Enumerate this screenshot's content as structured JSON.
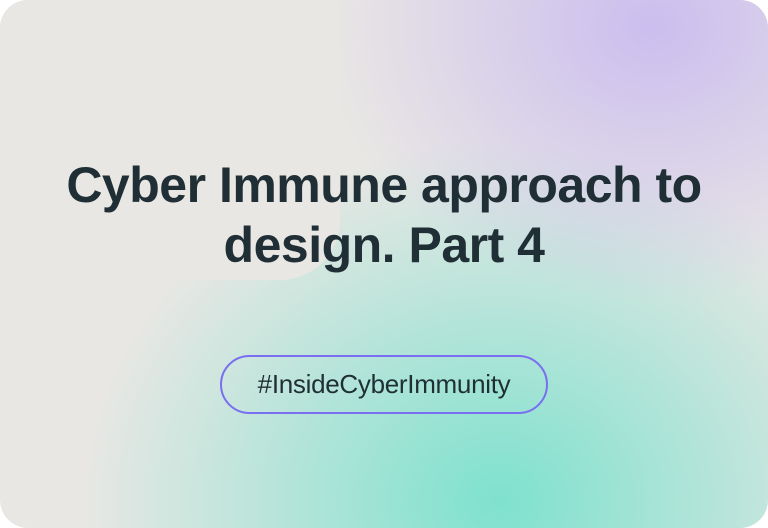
{
  "card": {
    "title": "Cyber Immune approach to design. Part 4",
    "hashtag": "#InsideCyberImmunity"
  },
  "colors": {
    "text": "#1f2f35",
    "pill_border": "#7a6ff0",
    "bg_neutral": "#e9e7e4",
    "gradient_mint": "#78e1cd",
    "gradient_lavender": "#c8b9f0"
  }
}
